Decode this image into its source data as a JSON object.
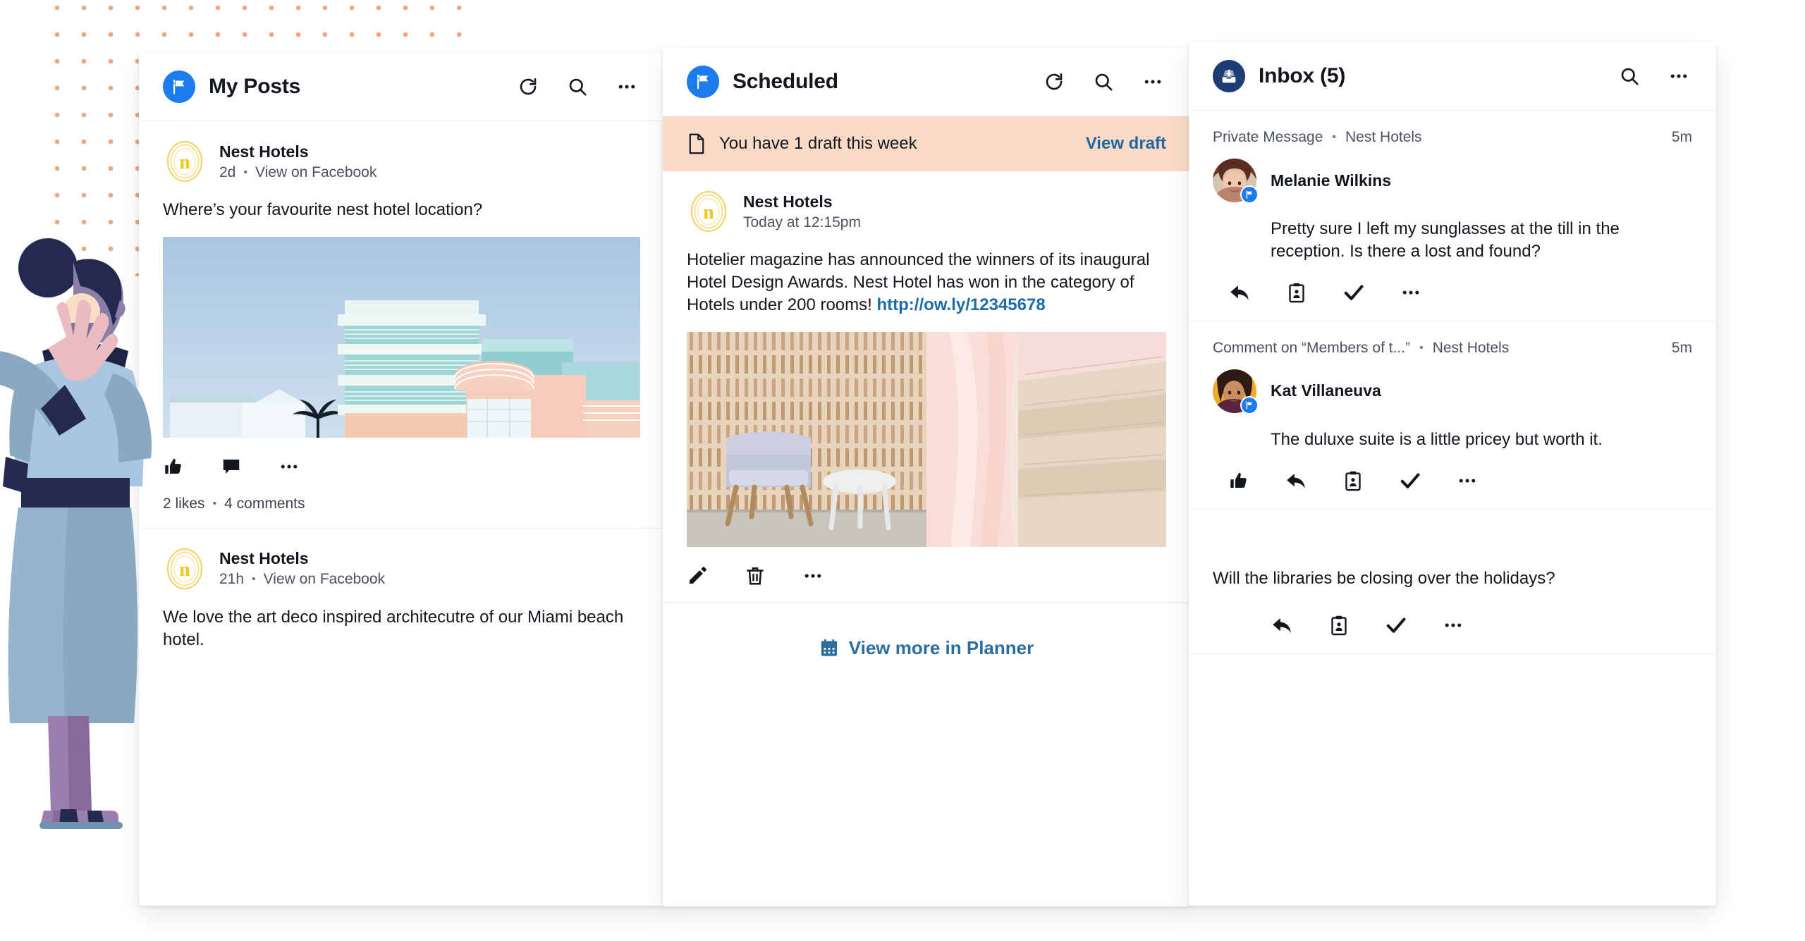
{
  "background": {
    "dot_color": "#f0a57d",
    "illustration": "woman-standing-illustration"
  },
  "colors": {
    "facebook_blue": "#1a7ced",
    "inbox_navy": "#1f3d75",
    "link_blue": "#1b6ca8",
    "draft_banner_bg": "#fadbc8",
    "text_primary": "#12161d",
    "text_secondary": "#4a5260"
  },
  "columns": {
    "my_posts": {
      "title": "My Posts",
      "icon": "facebook-page-flag-icon",
      "actions": [
        "refresh-icon",
        "search-icon",
        "more-icon"
      ],
      "posts": [
        {
          "author": "Nest Hotels",
          "avatar": "nest-hotels-logo",
          "time": "2d",
          "separator": "•",
          "source_link": "View on Facebook",
          "body": "Where’s your favourite nest hotel location?",
          "image": "art-deco-hotel-photo",
          "actions": [
            "like-icon",
            "comment-icon",
            "more-icon"
          ],
          "likes": "2 likes",
          "stats_separator": "•",
          "comments": "4 comments"
        },
        {
          "author": "Nest Hotels",
          "avatar": "nest-hotels-logo",
          "time": "21h",
          "separator": "•",
          "source_link": "View on Facebook",
          "body": "We love the art deco inspired architecutre of our Miami beach hotel."
        }
      ]
    },
    "scheduled": {
      "title": "Scheduled",
      "icon": "facebook-page-flag-icon",
      "actions": [
        "refresh-icon",
        "search-icon",
        "more-icon"
      ],
      "draft_banner": {
        "icon": "document-icon",
        "text": "You have 1 draft this week",
        "cta": "View draft"
      },
      "post": {
        "author": "Nest Hotels",
        "avatar": "nest-hotels-logo",
        "time": "Today at 12:15pm",
        "body": "Hotelier magazine has announced the winners of its inaugural Hotel Design Awards. Nest Hotel has won in the category of Hotels under 200 rooms! ",
        "link": "http://ow.ly/12345678",
        "image": "hotel-interior-chair-photo",
        "actions": [
          "edit-icon",
          "delete-icon",
          "more-icon"
        ]
      },
      "footer": {
        "icon": "calendar-icon",
        "label": "View more in Planner"
      }
    },
    "inbox": {
      "title": "Inbox (5)",
      "icon": "inbox-tray-icon",
      "actions": [
        "search-icon",
        "more-icon"
      ],
      "items": [
        {
          "type": "Private Message",
          "separator": "•",
          "account": "Nest Hotels",
          "time": "5m",
          "name": "Melanie Wilkins",
          "avatar": "melanie-wilkins-avatar",
          "network_badge": "facebook-page-flag-icon",
          "body": "Pretty sure I left my sunglasses at the till in the reception. Is there a lost and found?",
          "actions": [
            "reply-icon",
            "assign-icon",
            "resolve-check-icon",
            "more-icon"
          ]
        },
        {
          "type": "Comment on “Members of t...”",
          "separator": "•",
          "account": "Nest Hotels",
          "time": "5m",
          "name": "Kat Villaneuva",
          "avatar": "kat-villaneuva-avatar",
          "network_badge": "facebook-page-flag-icon",
          "body": "The duluxe suite is a little pricey but worth it.",
          "actions": [
            "like-icon",
            "reply-icon",
            "assign-icon",
            "resolve-check-icon",
            "more-icon"
          ]
        },
        {
          "body": "Will the libraries be closing over the holidays?",
          "actions": [
            "reply-icon",
            "assign-icon",
            "resolve-check-icon",
            "more-icon"
          ]
        }
      ]
    }
  }
}
